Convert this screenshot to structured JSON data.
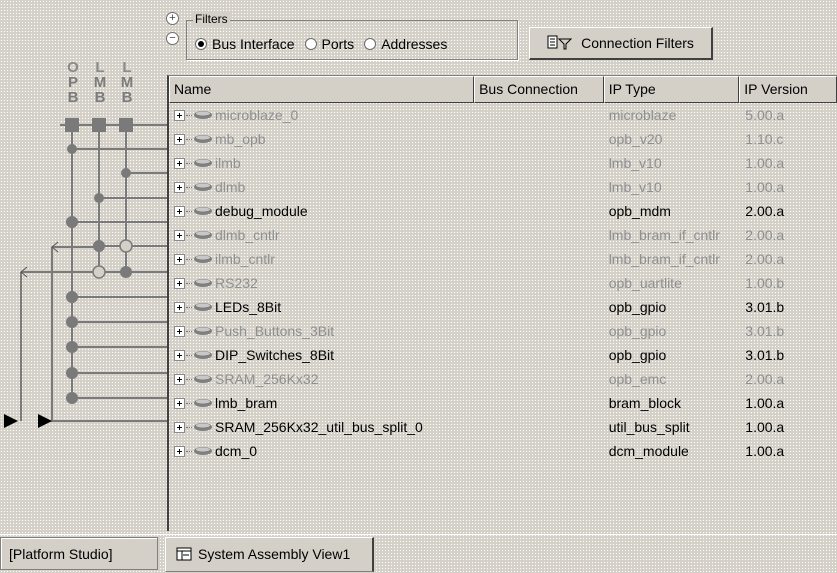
{
  "filters": {
    "legend": "Filters",
    "options": [
      {
        "label": "Bus Interface",
        "checked": true
      },
      {
        "label": "Ports",
        "checked": false
      },
      {
        "label": "Addresses",
        "checked": false
      }
    ],
    "connection_filters_label": "Connection Filters"
  },
  "buses": [
    {
      "lines": [
        "O",
        "P",
        "B"
      ]
    },
    {
      "lines": [
        "L",
        "M",
        "B"
      ]
    },
    {
      "lines": [
        "L",
        "M",
        "B"
      ]
    }
  ],
  "columns": [
    "Name",
    "Bus Connection",
    "IP Type",
    "IP Version"
  ],
  "rows": [
    {
      "name": "microblaze_0",
      "bus": "",
      "type": "microblaze",
      "version": "5.00.a",
      "dim": true
    },
    {
      "name": "mb_opb",
      "bus": "",
      "type": "opb_v20",
      "version": "1.10.c",
      "dim": true
    },
    {
      "name": "ilmb",
      "bus": "",
      "type": "lmb_v10",
      "version": "1.00.a",
      "dim": true
    },
    {
      "name": "dlmb",
      "bus": "",
      "type": "lmb_v10",
      "version": "1.00.a",
      "dim": true
    },
    {
      "name": "debug_module",
      "bus": "",
      "type": "opb_mdm",
      "version": "2.00.a",
      "dim": false
    },
    {
      "name": "dlmb_cntlr",
      "bus": "",
      "type": "lmb_bram_if_cntlr",
      "version": "2.00.a",
      "dim": true
    },
    {
      "name": "ilmb_cntlr",
      "bus": "",
      "type": "lmb_bram_if_cntlr",
      "version": "2.00.a",
      "dim": true
    },
    {
      "name": "RS232",
      "bus": "",
      "type": "opb_uartlite",
      "version": "1.00.b",
      "dim": true
    },
    {
      "name": "LEDs_8Bit",
      "bus": "",
      "type": "opb_gpio",
      "version": "3.01.b",
      "dim": false
    },
    {
      "name": "Push_Buttons_3Bit",
      "bus": "",
      "type": "opb_gpio",
      "version": "3.01.b",
      "dim": true
    },
    {
      "name": "DIP_Switches_8Bit",
      "bus": "",
      "type": "opb_gpio",
      "version": "3.01.b",
      "dim": false
    },
    {
      "name": "SRAM_256Kx32",
      "bus": "",
      "type": "opb_emc",
      "version": "2.00.a",
      "dim": true
    },
    {
      "name": "lmb_bram",
      "bus": "",
      "type": "bram_block",
      "version": "1.00.a",
      "dim": false
    },
    {
      "name": "SRAM_256Kx32_util_bus_split_0",
      "bus": "",
      "type": "util_bus_split",
      "version": "1.00.a",
      "dim": false
    },
    {
      "name": "dcm_0",
      "bus": "",
      "type": "dcm_module",
      "version": "1.00.a",
      "dim": false
    }
  ],
  "tabs": {
    "platform": "[Platform Studio]",
    "system_assembly": "System Assembly View1"
  },
  "colors": {
    "background": "#d4d0c8",
    "dim_text": "#8f8f8f",
    "bus_line": "#7a7a7a"
  }
}
